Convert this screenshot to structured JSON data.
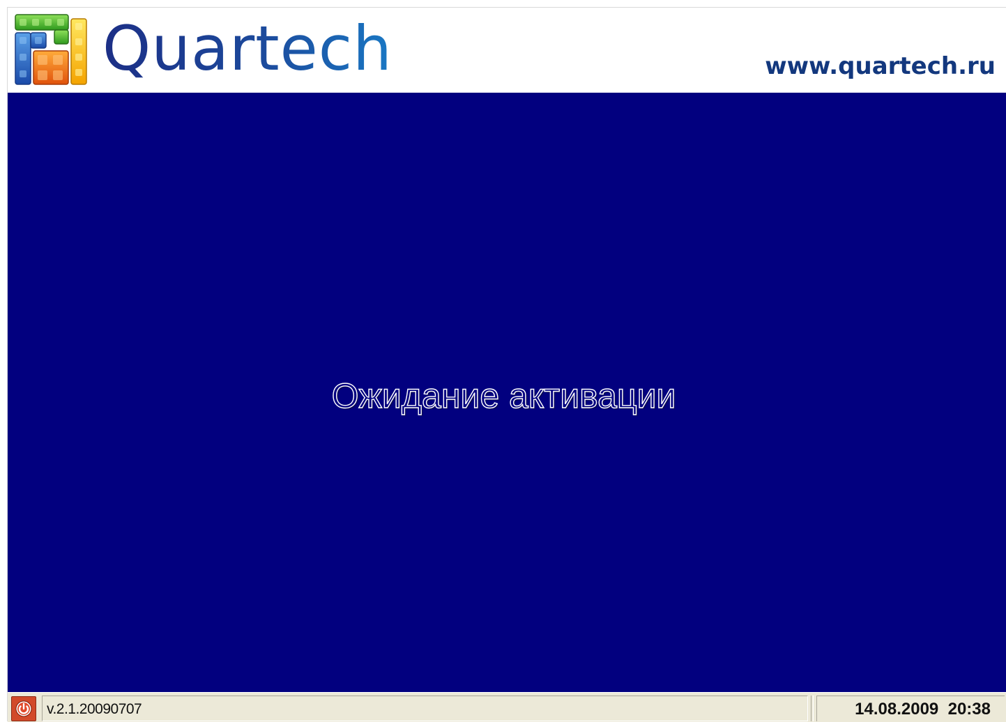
{
  "header": {
    "brand_name": "Quartech",
    "website": "www.quartech.ru",
    "logo_icon": "quartech-logo-icon"
  },
  "main": {
    "status_message": "Ожидание активации",
    "background_color": "#02007F"
  },
  "statusbar": {
    "power_icon": "power-icon",
    "version": "v.2.1.20090707",
    "datetime": "14.08.2009  20:38"
  },
  "colors": {
    "brand_blue": "#1D3A8F",
    "url_blue": "#13387E",
    "power_button": "#D24A2A",
    "statusbar_bg": "#ECE9D8"
  }
}
